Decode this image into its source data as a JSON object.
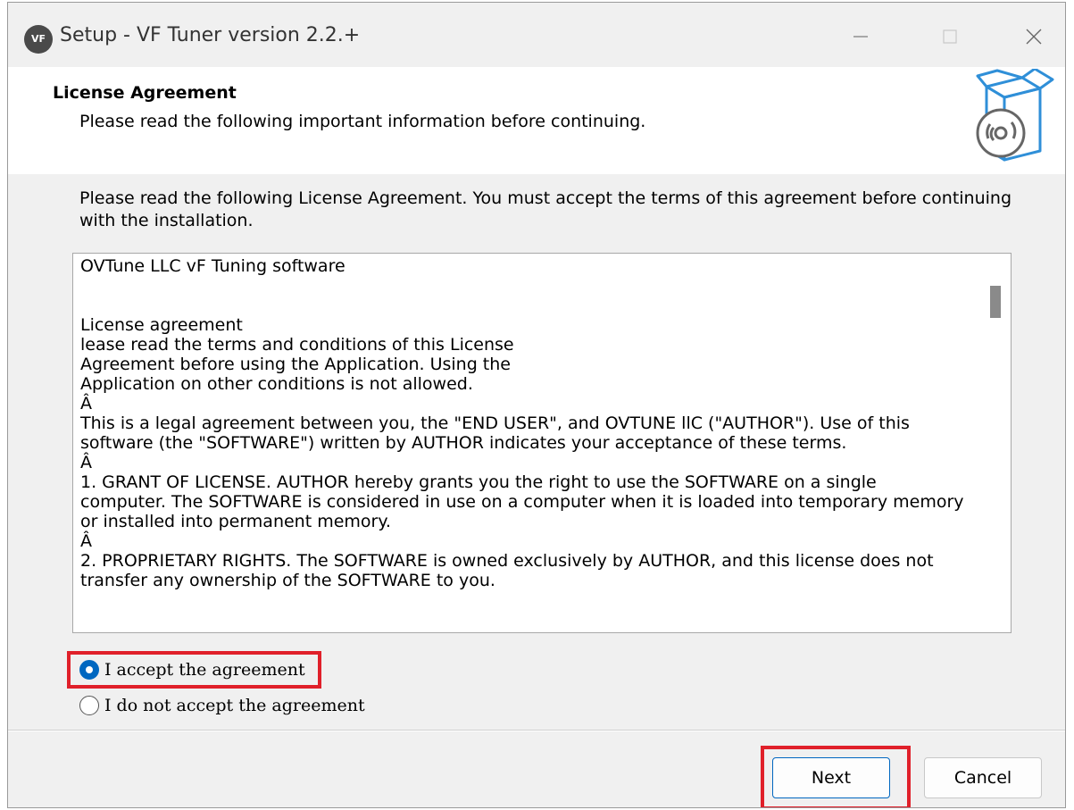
{
  "window": {
    "title": "Setup - VF Tuner version 2.2.+",
    "app_icon_text": "VF",
    "controls": [
      "minimize",
      "maximize",
      "close"
    ]
  },
  "header": {
    "title": "License Agreement",
    "subtitle": "Please read the following important information before continuing.",
    "logo_icon": "software-box-cd-icon"
  },
  "body": {
    "intro": "Please read the following License Agreement. You must accept the terms of this agreement before continuing with the installation.",
    "license_text": "OVTune LLC vF Tuning software\n\n\nLicense agreement\nlease read the terms and conditions of this License\nAgreement before using the Application. Using the\nApplication on other conditions is not allowed.\nÂ\nThis is a legal agreement between you, the \"END USER\", and OVTUNE llC (\"AUTHOR\"). Use of this\nsoftware (the \"SOFTWARE\") written by AUTHOR indicates your acceptance of these terms.\nÂ\n1. GRANT OF LICENSE. AUTHOR hereby grants you the right to use the SOFTWARE on a single\ncomputer. The SOFTWARE is considered in use on a computer when it is loaded into temporary memory\nor installed into permanent memory.\nÂ\n2. PROPRIETARY RIGHTS. The SOFTWARE is owned exclusively by AUTHOR, and this license does not\ntransfer any ownership of the SOFTWARE to you.",
    "accept_label": "I accept the agreement",
    "decline_label": "I do not accept the agreement",
    "selected": "accept"
  },
  "footer": {
    "next_label": "Next",
    "cancel_label": "Cancel"
  },
  "colors": {
    "accent": "#0067c0",
    "highlight": "#e0202a"
  }
}
